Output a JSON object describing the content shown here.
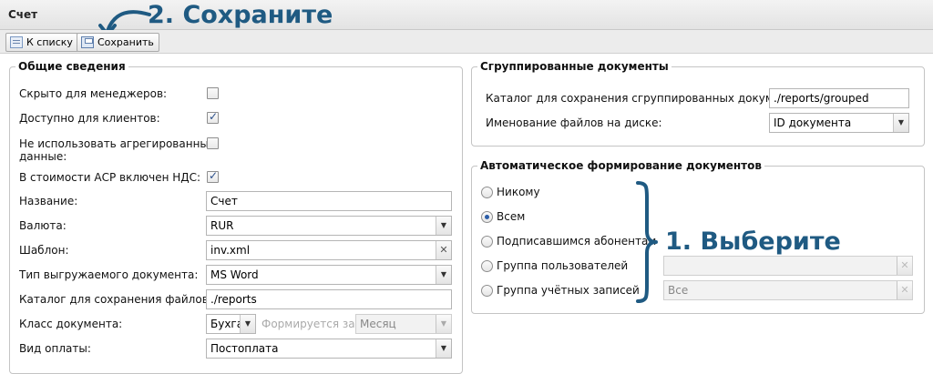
{
  "window": {
    "title": "Счет"
  },
  "callouts": {
    "save": "2. Сохраните",
    "choose": "1. Выберите"
  },
  "toolbar": {
    "back_label": "К списку",
    "save_label": "Сохранить"
  },
  "general": {
    "legend": "Общие сведения",
    "hidden_for_managers": {
      "label": "Скрыто для менеджеров:",
      "checked": false
    },
    "available_for_clients": {
      "label": "Доступно для клиентов:",
      "checked": true
    },
    "no_aggregated": {
      "label_line1": "Не использовать агрегированные",
      "label_line2": "данные:",
      "checked": false
    },
    "vat_included": {
      "label": "В стоимости АСР включен НДС:",
      "checked": true
    },
    "name": {
      "label": "Название:",
      "value": "Счет"
    },
    "currency": {
      "label": "Валюта:",
      "value": "RUR"
    },
    "template": {
      "label": "Шаблон:",
      "value": "inv.xml"
    },
    "doc_type": {
      "label": "Тип выгружаемого документа:",
      "value": "MS Word"
    },
    "files_dir": {
      "label": "Каталог для сохранения файлов:",
      "value": "./reports"
    },
    "doc_class": {
      "label": "Класс документа:",
      "value": "Бухга",
      "formed_for_label": "Формируется за:",
      "formed_for_value": "Месяц"
    },
    "payment_type": {
      "label": "Вид оплаты:",
      "value": "Постоплата"
    }
  },
  "grouped": {
    "legend": "Сгруппированные документы",
    "dir": {
      "label": "Каталог для сохранения сгруппированных документов:",
      "value": "./reports/grouped"
    },
    "naming": {
      "label": "Именование файлов на диске:",
      "value": "ID документа"
    }
  },
  "auto": {
    "legend": "Автоматическое формирование документов",
    "options": [
      {
        "label": "Никому",
        "selected": false
      },
      {
        "label": "Всем",
        "selected": true
      },
      {
        "label": "Подписавшимся абонентам",
        "selected": false
      },
      {
        "label": "Группа пользователей",
        "selected": false
      },
      {
        "label": "Группа учётных записей",
        "selected": false
      }
    ],
    "user_group_value": "",
    "account_group_value": "Все"
  },
  "icons": {
    "back": "list-arrow-icon",
    "save": "floppy-disk-icon",
    "dropdown": "chevron-down-icon",
    "clear": "clear-x-icon",
    "arrow": "curved-arrow-icon",
    "brace": "right-brace-icon"
  },
  "colors": {
    "callout": "#1f5a82",
    "check": "#2b4f8a"
  }
}
